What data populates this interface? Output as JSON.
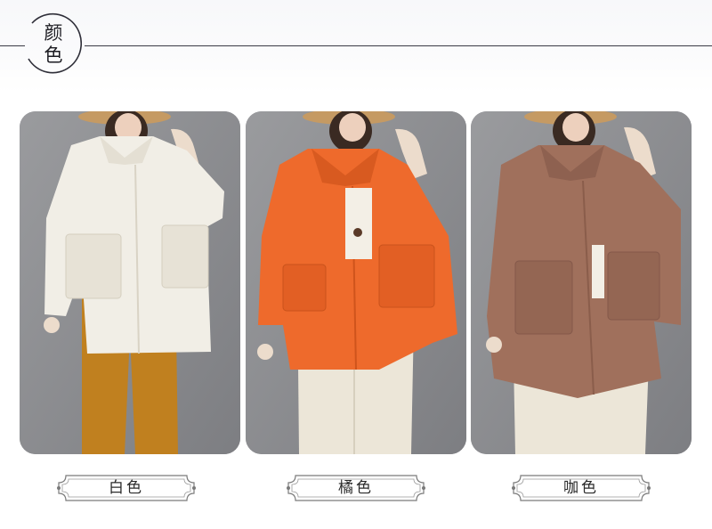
{
  "section": {
    "title_chars": [
      "颜",
      "色"
    ]
  },
  "colors": {
    "rule": "#3b3b45",
    "card_bg": "#8a8b8f",
    "label_border": "#7a7a7a"
  },
  "variants": [
    {
      "name": "白色",
      "garment_color": "#f1eee6",
      "pants_color": "#c0801f"
    },
    {
      "name": "橘色",
      "garment_color": "#ee6a2c",
      "pants_color": "#ece6d8"
    },
    {
      "name": "咖色",
      "garment_color": "#a0705c",
      "pants_color": "#ece6d8"
    }
  ]
}
